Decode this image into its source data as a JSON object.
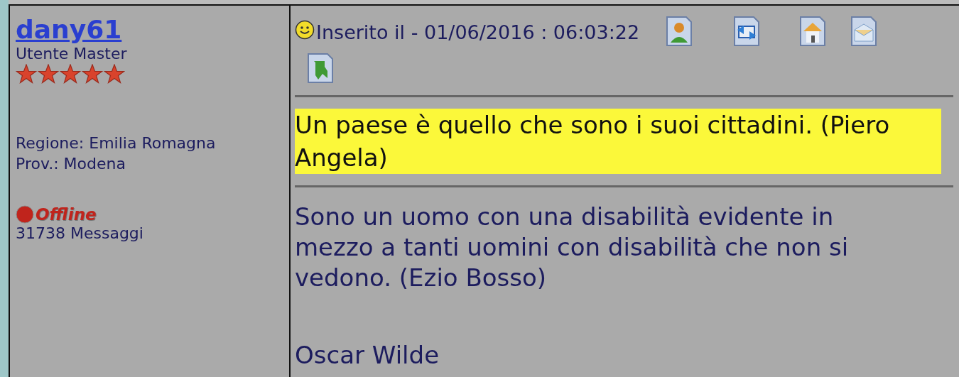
{
  "author": {
    "name": "dany61",
    "rank": "Utente Master",
    "stars": 5,
    "region": "Regione: Emilia Romagna",
    "province": "Prov.: Modena",
    "status": {
      "label": "Offline",
      "color": "#c0241c"
    },
    "posts": "31738 Messaggi"
  },
  "post": {
    "posted": "Inserito il - 01/06/2016 : 06:03:22",
    "actions": [
      {
        "kind": "profile"
      },
      {
        "kind": "sync"
      },
      {
        "kind": "home"
      },
      {
        "kind": "mail"
      },
      {
        "kind": "flag"
      }
    ],
    "quote": "Un paese è quello che sono i suoi cittadini. (Piero Angela)",
    "body": "Sono un uomo con una disabilità evidente in mezzo a tanti uomini con disabilità che non si vedono. (Ezio Bosso)",
    "signature": "Oscar Wilde"
  }
}
